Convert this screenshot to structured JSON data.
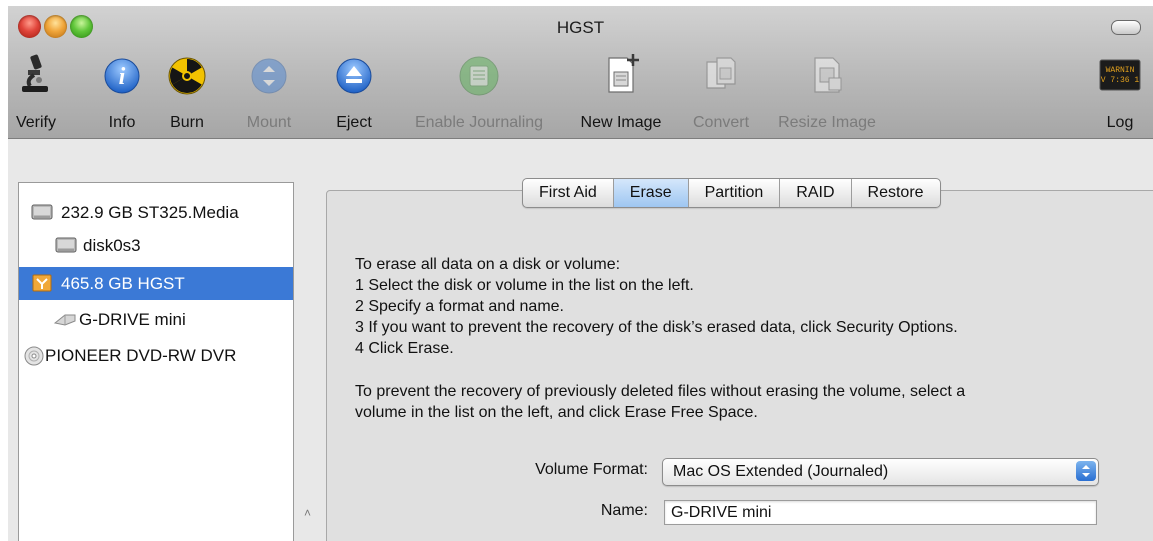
{
  "window": {
    "title": "HGST"
  },
  "toolbar": {
    "verify": "Verify",
    "info": "Info",
    "burn": "Burn",
    "mount": "Mount",
    "eject": "Eject",
    "enable_journaling": "Enable Journaling",
    "new_image": "New Image",
    "convert": "Convert",
    "resize_image": "Resize Image",
    "log": "Log",
    "log_icon_text": [
      "WARNIN",
      "V 7:36 1"
    ]
  },
  "sidebar": {
    "items": [
      {
        "label": "232.9 GB ST325.Media",
        "icon": "internal-disk-icon"
      },
      {
        "label": "disk0s3",
        "icon": "volume-icon"
      },
      {
        "label": "465.8 GB HGST",
        "icon": "external-disk-icon"
      },
      {
        "label": "G-DRIVE mini",
        "icon": "drive-volume-icon"
      },
      {
        "label": "PIONEER DVD-RW DVR",
        "icon": "optical-drive-icon"
      }
    ]
  },
  "tabs": [
    "First Aid",
    "Erase",
    "Partition",
    "RAID",
    "Restore"
  ],
  "instructions": {
    "intro": "To erase all data on a disk or volume:",
    "step1": "1 Select the disk or volume in the list on the left.",
    "step2": "2 Specify a format and name.",
    "step3": "3 If you want to prevent the recovery of the disk’s erased data, click Security Options.",
    "step4": "4 Click Erase.",
    "prevent_line1": "To prevent the recovery of previously deleted files without erasing the volume, select a",
    "prevent_line2": "volume in the list on the left, and click Erase Free Space."
  },
  "form": {
    "volume_format_label": "Volume Format:",
    "volume_format_value": "Mac OS Extended (Journaled)",
    "name_label": "Name:",
    "name_value": "G-DRIVE mini"
  },
  "colors": {
    "selection": "#3b79d6",
    "active_tab": "#9ec6f1",
    "info_blue": "#2a6fd2",
    "burn_yellow": "#f2c200"
  }
}
